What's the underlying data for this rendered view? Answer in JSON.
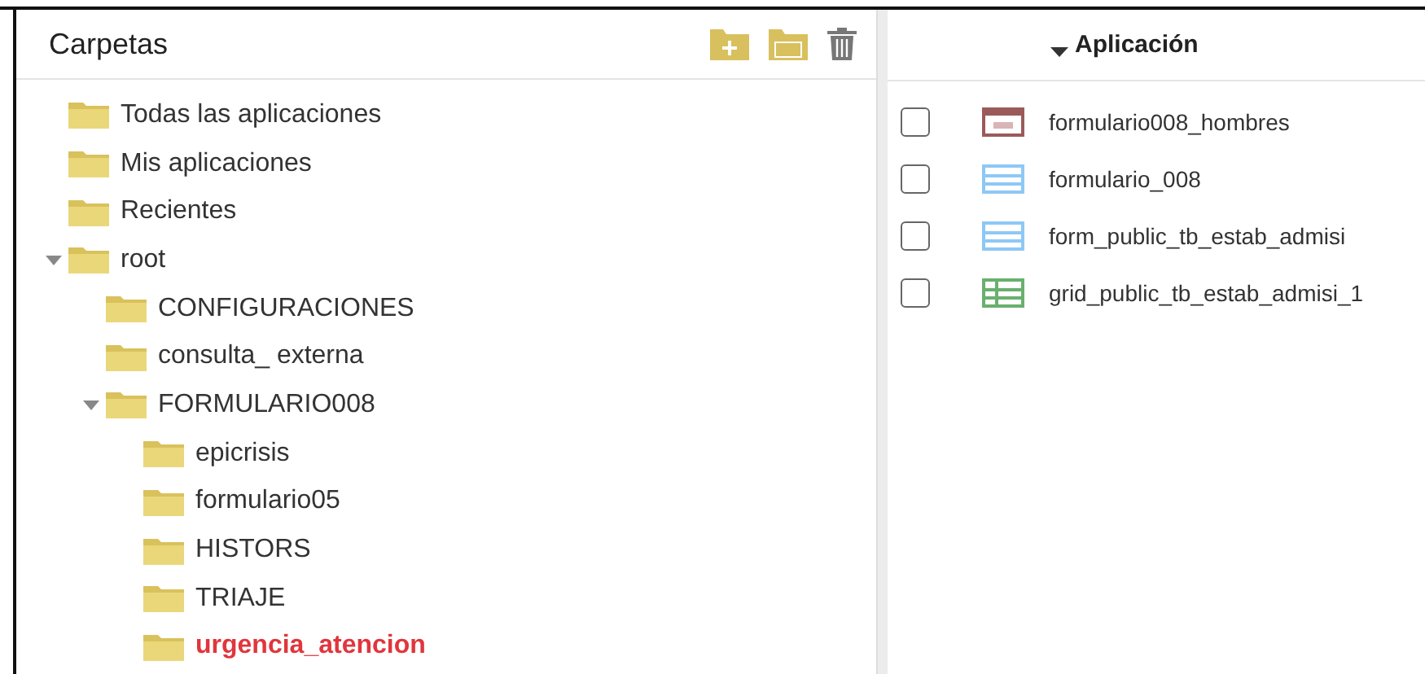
{
  "folders_panel": {
    "title": "Carpetas",
    "tree": [
      {
        "label": "Todas las aplicaciones",
        "selected": false
      },
      {
        "label": "Mis aplicaciones",
        "selected": false
      },
      {
        "label": "Recientes",
        "selected": false
      },
      {
        "label": "root",
        "selected": false,
        "expanded": true,
        "children": [
          {
            "label": "CONFIGURACIONES",
            "selected": false
          },
          {
            "label": "consulta_ externa",
            "selected": false
          },
          {
            "label": "FORMULARIO008",
            "selected": false,
            "expanded": true,
            "children": [
              {
                "label": "epicrisis",
                "selected": false
              },
              {
                "label": "formulario05",
                "selected": false
              },
              {
                "label": "HISTORS",
                "selected": false
              },
              {
                "label": "TRIAJE",
                "selected": false
              },
              {
                "label": "urgencia_atencion",
                "selected": true
              }
            ]
          }
        ]
      }
    ]
  },
  "applications_panel": {
    "column": "Aplicación",
    "rows": [
      {
        "name": "formulario008_hombres",
        "kind": "pdf",
        "checked": false
      },
      {
        "name": "formulario_008",
        "kind": "form",
        "checked": false
      },
      {
        "name": "form_public_tb_estab_admisi",
        "kind": "form",
        "checked": false
      },
      {
        "name": "grid_public_tb_estab_admisi_1",
        "kind": "grid",
        "checked": false
      }
    ]
  }
}
